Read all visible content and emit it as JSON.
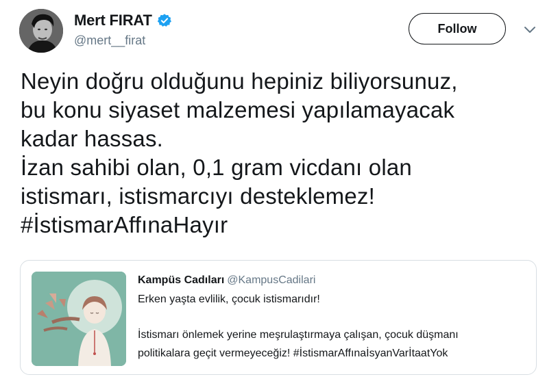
{
  "author": {
    "name": "Mert FIRAT",
    "handle": "@mert__firat",
    "verified": true,
    "verified_color": "#1da1f2"
  },
  "follow_button": {
    "label": "Follow"
  },
  "menu": {
    "icon": "chevron-down-icon"
  },
  "tweet": {
    "lines": [
      "Neyin doğru olduğunu hepiniz biliyorsunuz,",
      "bu konu siyaset malzemesi yapılamayacak",
      "kadar hassas.",
      "İzan sahibi olan, 0,1 gram vicdanı olan",
      "istismarı, istismarcıyı desteklemez!"
    ],
    "hashtag": "#İstismarAffınaHayır"
  },
  "quoted_tweet": {
    "name": "Kampüs Cadıları",
    "handle": "@KampusCadilari",
    "line1": "Erken yaşta evlilik, çocuk istismarıdır!",
    "line2": "İstismarı önlemek yerine meşrulaştırmaya çalışan, çocuk düşmanı",
    "line3": "politikalara geçit vermeyeceğiz! #İstismarAffınaİsyanVarİtaatYok",
    "image": "illustration-girl-with-braids-birds"
  },
  "colors": {
    "text": "#14171a",
    "secondary_text": "#657786",
    "border": "#d8dee3",
    "image_background": "#7fb6a6"
  }
}
